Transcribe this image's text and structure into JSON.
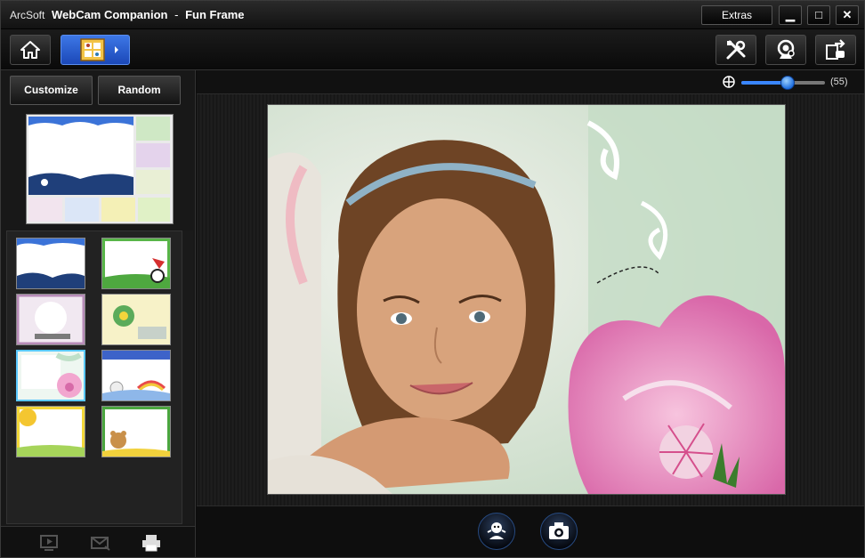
{
  "window": {
    "brand": "ArcSoft",
    "app_name": "WebCam Companion",
    "separator": "-",
    "mode": "Fun Frame",
    "extras_label": "Extras",
    "minimize_glyph": "▁",
    "maximize_glyph": "□",
    "close_glyph": "✕"
  },
  "toolbar": {
    "left_buttons": [
      "home-icon",
      "fun-frame-icon"
    ],
    "right_buttons": [
      "settings-tools-icon",
      "webcam-icon",
      "export-icon"
    ]
  },
  "left_panel": {
    "customize_label": "Customize",
    "random_label": "Random",
    "thumbnails": [
      {
        "theme": "ocean-waves"
      },
      {
        "theme": "panda-grass"
      },
      {
        "theme": "petal-nettle"
      },
      {
        "theme": "flower-power"
      },
      {
        "theme": "pink-flower",
        "selected": true
      },
      {
        "theme": "rainbow-kitty"
      },
      {
        "theme": "yellow-sun"
      },
      {
        "theme": "teddy-bear"
      }
    ],
    "footer_icons": [
      "slideshow-icon",
      "email-icon",
      "print-icon"
    ]
  },
  "zoom": {
    "value_label": "(55)",
    "level": 0.55
  },
  "bottom_actions": [
    "effects-icon",
    "camera-capture-icon"
  ],
  "colors": {
    "accent_blue": "#3a86ff",
    "mode_button": "#2f63d6",
    "selected_border": "#5ac8ff"
  }
}
